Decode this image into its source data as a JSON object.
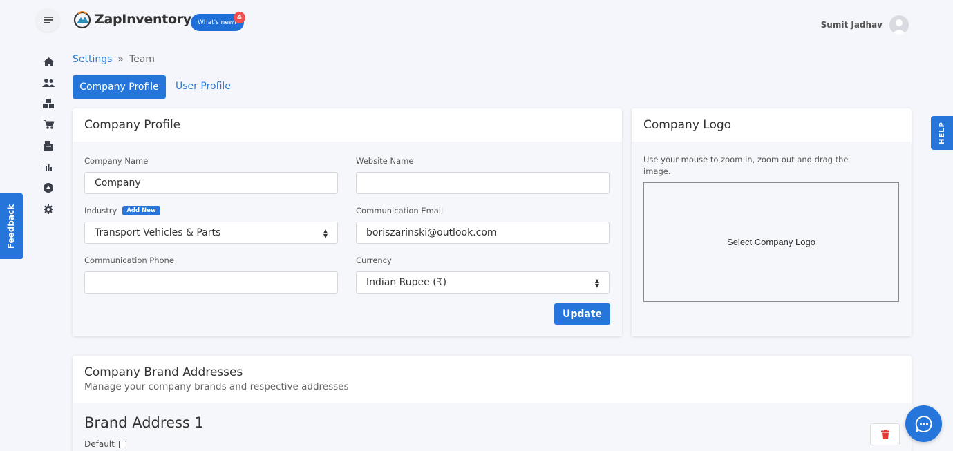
{
  "app": {
    "name": "ZapInventory",
    "whats_new_label": "What's new?",
    "whats_new_count": "4"
  },
  "header": {
    "user_name": "Sumit Jadhav"
  },
  "sidebar": {
    "items": [
      {
        "icon": "home-icon"
      },
      {
        "icon": "users-icon"
      },
      {
        "icon": "inventory-icon"
      },
      {
        "icon": "cart-icon"
      },
      {
        "icon": "register-icon"
      },
      {
        "icon": "reports-icon"
      },
      {
        "icon": "upload-icon"
      },
      {
        "icon": "gear-icon"
      }
    ]
  },
  "breadcrumb": {
    "parent": "Settings",
    "separator": "»",
    "current": "Team"
  },
  "tabs": {
    "company_profile": "Company Profile",
    "user_profile": "User Profile"
  },
  "company_profile": {
    "title": "Company Profile",
    "company_name_label": "Company Name",
    "company_name_value": "Company",
    "website_label": "Website Name",
    "website_value": "",
    "industry_label": "Industry",
    "add_new_label": "Add New",
    "industry_value": "Transport Vehicles & Parts",
    "email_label": "Communication Email",
    "email_value": "boriszarinski@outlook.com",
    "phone_label": "Communication Phone",
    "phone_value": "",
    "currency_label": "Currency",
    "currency_value": "Indian Rupee (₹)",
    "update_label": "Update"
  },
  "company_logo": {
    "title": "Company Logo",
    "hint": "Use your mouse to zoom in, zoom out and drag the image.",
    "select_label": "Select Company Logo"
  },
  "brand_addresses": {
    "title": "Company Brand Addresses",
    "subtitle": "Manage your company brands and respective addresses",
    "address_title": "Brand Address 1",
    "default_label": "Default"
  },
  "side_tabs": {
    "feedback": "Feedback",
    "help": "HELP"
  },
  "colors": {
    "primary": "#2575db",
    "badge": "#ef4f4f",
    "delete": "#e53935"
  }
}
